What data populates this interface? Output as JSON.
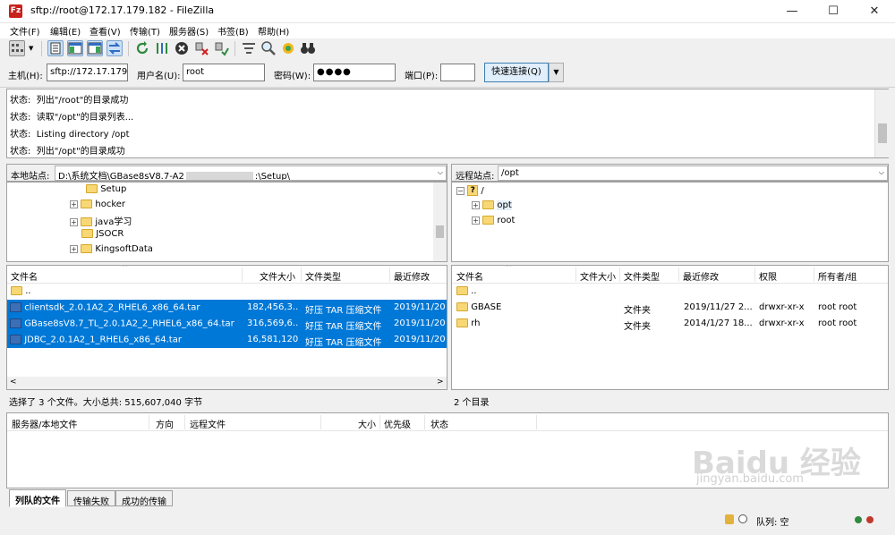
{
  "window": {
    "title": "sftp://root@172.17.179.182 - FileZilla",
    "icon_label": "Fz",
    "minimize": "—",
    "maximize": "☐",
    "close": "✕"
  },
  "menu": [
    "文件(F)",
    "编辑(E)",
    "查看(V)",
    "传输(T)",
    "服务器(S)",
    "书签(B)",
    "帮助(H)"
  ],
  "toolbar": {
    "icons": [
      "site-manager-icon",
      "dropdown-arrow-icon",
      "toggle-message-log-icon",
      "toggle-local-tree-icon",
      "toggle-remote-tree-icon",
      "toggle-queue-icon",
      "refresh-icon",
      "process-queue-icon",
      "cancel-icon",
      "disconnect-icon",
      "reconnect-icon",
      "directory-filter-icon",
      "search-icon",
      "compare-icon",
      "binoculars-icon"
    ]
  },
  "quickconnect": {
    "host_label": "主机(H):",
    "host_value": "sftp://172.17.179.",
    "user_label": "用户名(U):",
    "user_value": "root",
    "pass_label": "密码(W):",
    "pass_value": "●●●●",
    "port_label": "端口(P):",
    "port_value": "",
    "button": "快速连接(Q)",
    "dropdown": "▼"
  },
  "log": [
    {
      "prefix": "状态:",
      "text": "列出\"/root\"的目录成功"
    },
    {
      "prefix": "状态:",
      "text": "读取\"/opt\"的目录列表..."
    },
    {
      "prefix": "状态:",
      "text": "Listing directory /opt"
    },
    {
      "prefix": "状态:",
      "text": "列出\"/opt\"的目录成功"
    }
  ],
  "local": {
    "site_label": "本地站点:",
    "path": "D:\\系统文档\\GBase8sV8.7-A2",
    "path_tail": ":\\Setup\\",
    "tree": [
      {
        "name": "Setup",
        "expandable": false,
        "indent": 2
      },
      {
        "name": "hocker",
        "expandable": true,
        "indent": 1
      },
      {
        "name": "java学习",
        "expandable": true,
        "indent": 1
      },
      {
        "name": "JSOCR",
        "expandable": false,
        "indent": 1
      },
      {
        "name": "KingsoftData",
        "expandable": true,
        "indent": 1
      }
    ],
    "columns": [
      "文件名",
      "文件大小",
      "文件类型",
      "最近修改"
    ],
    "files": [
      {
        "name": "..",
        "size": "",
        "type": "",
        "modified": "",
        "icon": "folder",
        "selected": false
      },
      {
        "name": "clientsdk_2.0.1A2_2_RHEL6_x86_64.tar",
        "size": "182,456,3...",
        "type": "好压 TAR 压缩文件",
        "modified": "2019/11/20",
        "icon": "archive",
        "selected": true
      },
      {
        "name": "GBase8sV8.7_TL_2.0.1A2_2_RHEL6_x86_64.tar",
        "size": "316,569,6...",
        "type": "好压 TAR 压缩文件",
        "modified": "2019/11/20",
        "icon": "archive",
        "selected": true
      },
      {
        "name": "JDBC_2.0.1A2_1_RHEL6_x86_64.tar",
        "size": "16,581,120",
        "type": "好压 TAR 压缩文件",
        "modified": "2019/11/20",
        "icon": "archive",
        "selected": true
      }
    ],
    "status": "选择了 3 个文件。大小总共: 515,607,040 字节"
  },
  "remote": {
    "site_label": "远程站点:",
    "path": "/opt",
    "tree": [
      {
        "name": "/",
        "expandable": true,
        "indent": 0,
        "icon": "unknown"
      },
      {
        "name": "opt",
        "expandable": true,
        "indent": 1,
        "icon": "folder"
      },
      {
        "name": "root",
        "expandable": true,
        "indent": 1,
        "icon": "folder"
      }
    ],
    "columns": [
      "文件名",
      "文件大小",
      "文件类型",
      "最近修改",
      "权限",
      "所有者/组"
    ],
    "files": [
      {
        "name": "..",
        "size": "",
        "type": "",
        "modified": "",
        "perms": "",
        "owner": ""
      },
      {
        "name": "GBASE",
        "size": "",
        "type": "文件夹",
        "modified": "2019/11/27 2...",
        "perms": "drwxr-xr-x",
        "owner": "root root"
      },
      {
        "name": "rh",
        "size": "",
        "type": "文件夹",
        "modified": "2014/1/27 18...",
        "perms": "drwxr-xr-x",
        "owner": "root root"
      }
    ],
    "status": "2 个目录"
  },
  "queue": {
    "columns": [
      "服务器/本地文件",
      "方向",
      "远程文件",
      "大小",
      "优先级",
      "状态"
    ],
    "tabs": [
      "列队的文件",
      "传输失败",
      "成功的传输"
    ],
    "status": "队列: 空"
  },
  "watermark": {
    "brand": "Baidu 经验",
    "url": "jingyan.baidu.com"
  }
}
